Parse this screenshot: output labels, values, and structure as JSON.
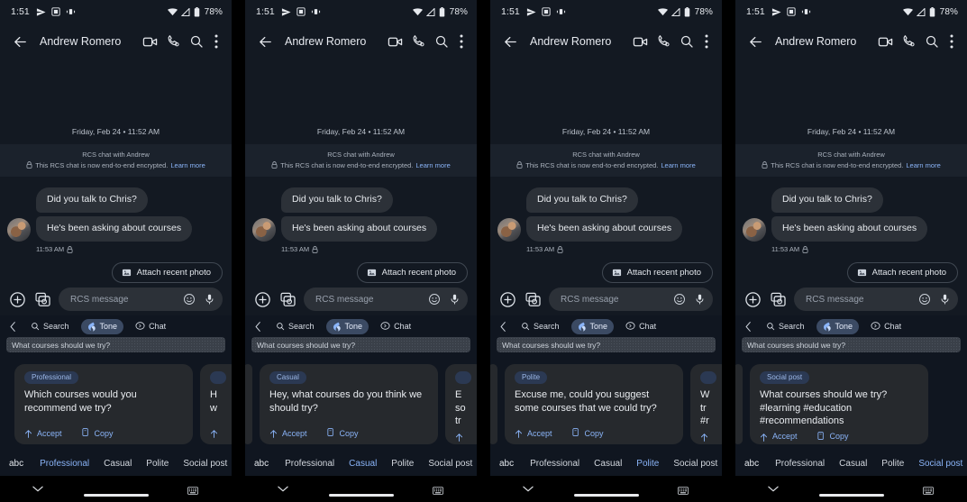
{
  "status_bar": {
    "time": "1:51",
    "left_icons": [
      "send-icon",
      "screenshot-icon",
      "vibrate-icon"
    ],
    "right_icons": [
      "wifi-icon",
      "signal-icon",
      "battery-icon"
    ],
    "battery": "78%"
  },
  "app_bar": {
    "back_icon": "arrow-back-icon",
    "contact_name": "Andrew Romero",
    "actions": [
      "video-call-icon",
      "phone-call-icon",
      "search-icon",
      "more-vert-icon"
    ]
  },
  "conversation": {
    "day_stamp": "Friday, Feb 24 • 11:52 AM",
    "rcs_banner_line1": "RCS chat with Andrew",
    "rcs_banner_line2": "This RCS chat is now end-to-end encrypted.",
    "rcs_banner_link": "Learn more",
    "lock_icon": "lock-icon",
    "messages": [
      {
        "text": "Did you talk to Chris?"
      },
      {
        "text": "He's been asking about courses"
      }
    ],
    "message_time": "11:53 AM",
    "attach_chip": {
      "icon": "photo-icon",
      "label": "Attach recent photo"
    }
  },
  "compose": {
    "plus_icon": "plus-circle-icon",
    "gallery_icon": "gallery-camera-icon",
    "placeholder": "RCS message",
    "emoji_icon": "emoji-icon",
    "mic_icon": "microphone-icon"
  },
  "toolbar": {
    "chevron_icon": "chevron-left-icon",
    "items": [
      {
        "label": "Search",
        "icon": "search-icon",
        "active": false
      },
      {
        "label": "Tone",
        "icon": "tone-icon",
        "active": true
      },
      {
        "label": "Chat",
        "icon": "chat-bubble-icon",
        "active": false
      }
    ]
  },
  "query": {
    "text": "What courses should we try?"
  },
  "card_actions": {
    "accept_label": "Accept",
    "accept_icon": "arrow-up-icon",
    "copy_label": "Copy",
    "copy_icon": "copy-icon"
  },
  "tone_tabs_abc": "abc",
  "tone_tabs": [
    "Professional",
    "Casual",
    "Polite",
    "Social post"
  ],
  "system_nav": {
    "chevron_icon": "chevron-down-icon",
    "keyboard_icon": "keyboard-icon",
    "home_indicator": "home-indicator"
  },
  "colors": {
    "accent": "#8ab4f8",
    "panel_bg": "#131922",
    "card_bg": "#26292d",
    "bubble_bg": "#2c3138",
    "chip_bg": "#2b3953",
    "tool_bg": "#101620"
  },
  "panels": [
    {
      "selected_tone": "Professional",
      "card": {
        "tone": "Professional",
        "text": "Which courses would you recommend we try?"
      },
      "peek_left": false,
      "peek_right_text": "H\nw"
    },
    {
      "selected_tone": "Casual",
      "card": {
        "tone": "Casual",
        "text": "Hey, what courses do you think we should try?"
      },
      "peek_left": true,
      "peek_right_text": "E\nso\ntr"
    },
    {
      "selected_tone": "Polite",
      "card": {
        "tone": "Polite",
        "text": "Excuse me, could you suggest some courses that we could try?"
      },
      "peek_left": true,
      "peek_right_text": "W\ntr\n#r"
    },
    {
      "selected_tone": "Social post",
      "card": {
        "tone": "Social post",
        "text": "What courses should we try? #learning #education #recommendations"
      },
      "peek_left": true,
      "peek_right_text": ""
    }
  ]
}
